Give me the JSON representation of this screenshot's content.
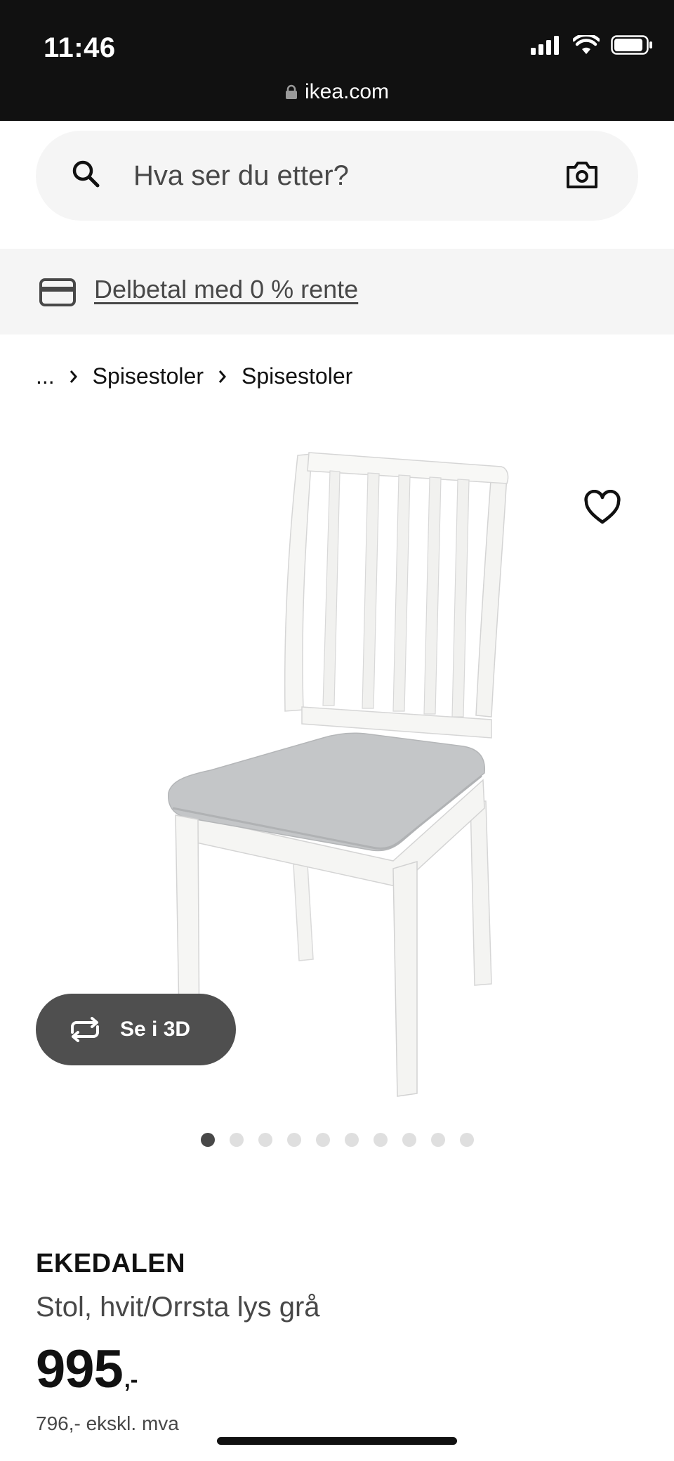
{
  "status_bar": {
    "time": "11:46",
    "url": "ikea.com",
    "icons": [
      "signal-icon",
      "wifi-icon",
      "battery-icon"
    ]
  },
  "search": {
    "placeholder": "Hva ser du etter?",
    "icons": [
      "search-icon",
      "camera-icon"
    ]
  },
  "promo": {
    "link_text": "Delbetal med 0 % rente",
    "icon": "credit-card-icon"
  },
  "breadcrumb": {
    "items": [
      "...",
      "Spisestoler",
      "Spisestoler"
    ]
  },
  "gallery": {
    "see_3d_label": "Se i 3D",
    "image_count": 10,
    "active_index": 0
  },
  "product": {
    "name": "EKEDALEN",
    "description": "Stol, hvit/Orrsta lys grå",
    "price": "995",
    "price_suffix": ",-",
    "price_ex_vat": "796,- ekskl. mva"
  },
  "colors": {
    "status_bar_bg": "#111111",
    "search_bg": "#f5f5f5",
    "see_3d_bg": "#4f4f4f",
    "seat_grey": "#c4c6c8",
    "text_secondary": "#484848"
  }
}
